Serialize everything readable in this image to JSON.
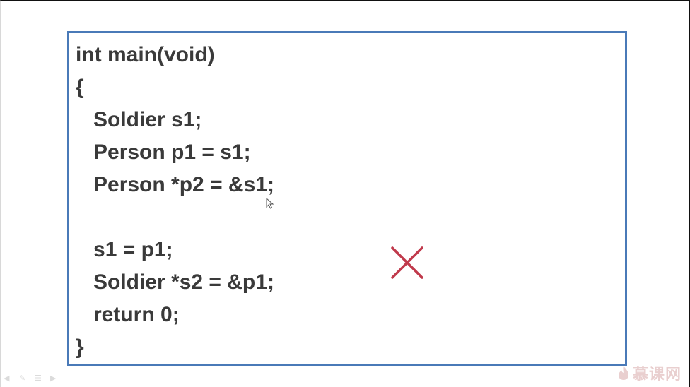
{
  "slide": {
    "code_lines": [
      "int main(void)",
      "{",
      "   Soldier s1;",
      "   Person p1 = s1;",
      "   Person *p2 = &s1;",
      "",
      "   s1 = p1;",
      "   Soldier *s2 = &p1;",
      "   return 0;",
      "}"
    ],
    "wrong_mark_icon": "cross-icon",
    "wrong_mark_color": "#c0394b",
    "box_border_color": "#4a7ab8"
  },
  "watermark": {
    "text": "慕课网",
    "icon": "flame-logo-icon"
  },
  "player_controls": [
    "prev-icon",
    "pen-icon",
    "menu-icon",
    "next-icon"
  ]
}
